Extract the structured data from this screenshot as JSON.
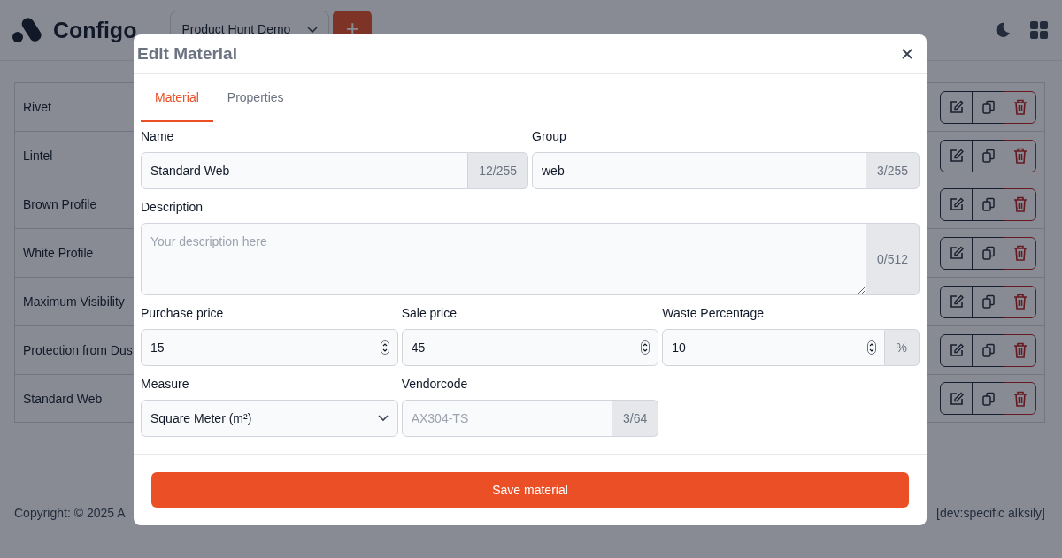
{
  "app": {
    "logo": "Configo",
    "project_select": "Product Hunt Demo",
    "add_button": "+"
  },
  "materials": [
    {
      "name": "Rivet"
    },
    {
      "name": "Lintel"
    },
    {
      "name": "Brown Profile"
    },
    {
      "name": "White Profile"
    },
    {
      "name": "Maximum Visibility"
    },
    {
      "name": "Protection from Dus"
    },
    {
      "name": "Standard Web"
    }
  ],
  "footer": {
    "copyright": "Copyright: © 2025 A",
    "build": "[dev:specific alksily]"
  },
  "dialog": {
    "title": "Edit Material",
    "tabs": [
      {
        "label": "Material",
        "selected": true
      },
      {
        "label": "Properties",
        "selected": false
      }
    ],
    "rows": [
      [
        {
          "kind": "text",
          "label": "Name",
          "value": "Standard Web",
          "counter": "12/255"
        },
        {
          "kind": "text",
          "label": "Group",
          "value": "web",
          "counter": "3/255"
        }
      ],
      [
        {
          "kind": "textarea",
          "label": "Description",
          "placeholder": "Your description here",
          "counter": "0/512"
        }
      ],
      [
        {
          "kind": "number",
          "label": "Purchase price",
          "value": "15"
        },
        {
          "kind": "number",
          "label": "Sale price",
          "value": "45"
        },
        {
          "kind": "number",
          "label": "Waste Percentage",
          "value": "10",
          "suffix": "%"
        }
      ],
      [
        {
          "kind": "select",
          "label": "Measure",
          "value": "Square Meter (m²)"
        },
        {
          "kind": "text",
          "label": "Vendorcode",
          "placeholder": "AX304-TS",
          "counter": "3/64"
        }
      ]
    ],
    "save_button": "Save material"
  }
}
